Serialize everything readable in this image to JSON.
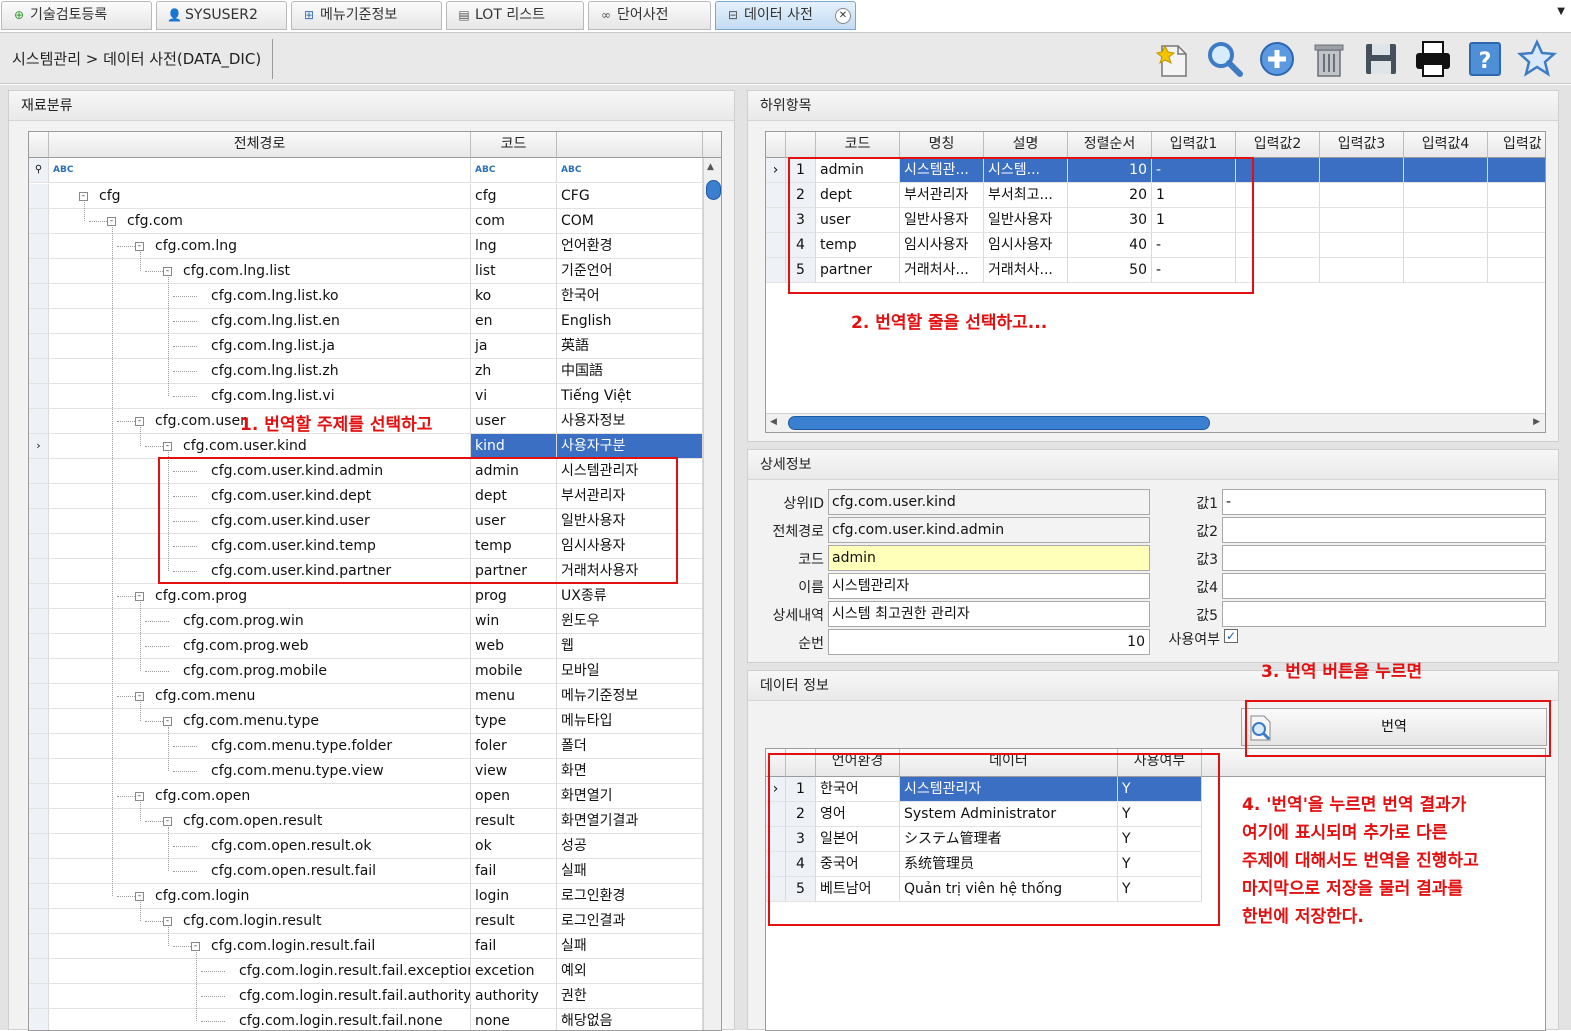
{
  "tabs": [
    {
      "label": "기술검토등록",
      "icon": "plus-circle-icon"
    },
    {
      "label": "SYSUSER2",
      "icon": "user-icon"
    },
    {
      "label": "메뉴기준정보",
      "icon": "sitemap-icon"
    },
    {
      "label": "LOT 리스트",
      "icon": "list-icon"
    },
    {
      "label": "단어사전",
      "icon": "binoculars-icon"
    },
    {
      "label": "데이터 사전",
      "icon": "database-icon",
      "active": true
    }
  ],
  "breadcrumb": "시스템관리  >  데이터 사전(DATA_DIC)",
  "toolbar_icons": [
    "new-document-icon",
    "search-icon",
    "add-icon",
    "delete-icon",
    "save-icon",
    "print-icon",
    "help-icon",
    "favorite-icon"
  ],
  "left_panel": {
    "title": "재료분류",
    "headers": [
      "전체경로",
      "코드",
      ""
    ],
    "filter_glyph": "ABC",
    "rows": [
      {
        "path": "cfg",
        "code": "cfg",
        "name": "CFG",
        "level": 0,
        "toggle": "-"
      },
      {
        "path": "cfg.com",
        "code": "com",
        "name": "COM",
        "level": 1,
        "toggle": "-"
      },
      {
        "path": "cfg.com.lng",
        "code": "lng",
        "name": "언어환경",
        "level": 2,
        "toggle": "-"
      },
      {
        "path": "cfg.com.lng.list",
        "code": "list",
        "name": "기준언어",
        "level": 3,
        "toggle": "-"
      },
      {
        "path": "cfg.com.lng.list.ko",
        "code": "ko",
        "name": "한국어",
        "level": 4
      },
      {
        "path": "cfg.com.lng.list.en",
        "code": "en",
        "name": "English",
        "level": 4
      },
      {
        "path": "cfg.com.lng.list.ja",
        "code": "ja",
        "name": "英語",
        "level": 4
      },
      {
        "path": "cfg.com.lng.list.zh",
        "code": "zh",
        "name": "中国語",
        "level": 4
      },
      {
        "path": "cfg.com.lng.list.vi",
        "code": "vi",
        "name": "Tiếng Việt",
        "level": 4
      },
      {
        "path": "cfg.com.user",
        "code": "user",
        "name": "사용자정보",
        "level": 2,
        "toggle": "-"
      },
      {
        "path": "cfg.com.user.kind",
        "code": "kind",
        "name": "사용자구분",
        "level": 3,
        "toggle": "-",
        "selected": true
      },
      {
        "path": "cfg.com.user.kind.admin",
        "code": "admin",
        "name": "시스템관리자",
        "level": 4
      },
      {
        "path": "cfg.com.user.kind.dept",
        "code": "dept",
        "name": "부서관리자",
        "level": 4
      },
      {
        "path": "cfg.com.user.kind.user",
        "code": "user",
        "name": "일반사용자",
        "level": 4
      },
      {
        "path": "cfg.com.user.kind.temp",
        "code": "temp",
        "name": "임시사용자",
        "level": 4
      },
      {
        "path": "cfg.com.user.kind.partner",
        "code": "partner",
        "name": "거래처사용자",
        "level": 4
      },
      {
        "path": "cfg.com.prog",
        "code": "prog",
        "name": "UX종류",
        "level": 2,
        "toggle": "-"
      },
      {
        "path": "cfg.com.prog.win",
        "code": "win",
        "name": "윈도우",
        "level": 3
      },
      {
        "path": "cfg.com.prog.web",
        "code": "web",
        "name": "웹",
        "level": 3
      },
      {
        "path": "cfg.com.prog.mobile",
        "code": "mobile",
        "name": "모바일",
        "level": 3
      },
      {
        "path": "cfg.com.menu",
        "code": "menu",
        "name": "메뉴기준정보",
        "level": 2,
        "toggle": "-"
      },
      {
        "path": "cfg.com.menu.type",
        "code": "type",
        "name": "메뉴타입",
        "level": 3,
        "toggle": "-"
      },
      {
        "path": "cfg.com.menu.type.folder",
        "code": "foler",
        "name": "폴더",
        "level": 4
      },
      {
        "path": "cfg.com.menu.type.view",
        "code": "view",
        "name": "화면",
        "level": 4
      },
      {
        "path": "cfg.com.open",
        "code": "open",
        "name": "화면열기",
        "level": 2,
        "toggle": "-"
      },
      {
        "path": "cfg.com.open.result",
        "code": "result",
        "name": "화면열기결과",
        "level": 3,
        "toggle": "-"
      },
      {
        "path": "cfg.com.open.result.ok",
        "code": "ok",
        "name": "성공",
        "level": 4
      },
      {
        "path": "cfg.com.open.result.fail",
        "code": "fail",
        "name": "실패",
        "level": 4
      },
      {
        "path": "cfg.com.login",
        "code": "login",
        "name": "로그인환경",
        "level": 2,
        "toggle": "-"
      },
      {
        "path": "cfg.com.login.result",
        "code": "result",
        "name": "로그인결과",
        "level": 3,
        "toggle": "-"
      },
      {
        "path": "cfg.com.login.result.fail",
        "code": "fail",
        "name": "실패",
        "level": 4,
        "toggle": "-"
      },
      {
        "path": "cfg.com.login.result.fail.exception",
        "code": "excetion",
        "name": "예외",
        "level": 5
      },
      {
        "path": "cfg.com.login.result.fail.authority",
        "code": "authority",
        "name": "권한",
        "level": 5
      },
      {
        "path": "cfg.com.login.result.fail.none",
        "code": "none",
        "name": "해당없음",
        "level": 5
      }
    ]
  },
  "sub_panel": {
    "title": "하위항목",
    "headers": [
      "코드",
      "명칭",
      "설명",
      "정렬순서",
      "입력값1",
      "입력값2",
      "입력값3",
      "입력값4",
      "입력값"
    ],
    "rows": [
      {
        "no": "1",
        "code": "admin",
        "name": "시스템관...",
        "desc": "시스템...",
        "order": "10",
        "v1": "-",
        "selected": true
      },
      {
        "no": "2",
        "code": "dept",
        "name": "부서관리자",
        "desc": "부서최고...",
        "order": "20",
        "v1": "1"
      },
      {
        "no": "3",
        "code": "user",
        "name": "일반사용자",
        "desc": "일반사용자",
        "order": "30",
        "v1": "1"
      },
      {
        "no": "4",
        "code": "temp",
        "name": "임시사용자",
        "desc": "임시사용자",
        "order": "40",
        "v1": "-"
      },
      {
        "no": "5",
        "code": "partner",
        "name": "거래처사...",
        "desc": "거래처사...",
        "order": "50",
        "v1": "-"
      }
    ]
  },
  "detail_panel": {
    "title": "상세정보",
    "parent_id_label": "상위ID",
    "parent_id": "cfg.com.user.kind",
    "full_path_label": "전체경로",
    "full_path": "cfg.com.user.kind.admin",
    "code_label": "코드",
    "code": "admin",
    "name_label": "이름",
    "name": "시스템관리자",
    "detail_label": "상세내역",
    "detail": "시스템 최고권한 관리자",
    "seq_label": "순번",
    "seq": "10",
    "value_labels": [
      "값1",
      "값2",
      "값3",
      "값4",
      "값5"
    ],
    "values": [
      "-",
      "",
      "",
      "",
      ""
    ],
    "use_label": "사용여부",
    "use_checked": true
  },
  "data_panel": {
    "title": "데이터 정보",
    "translate_label": "번역",
    "headers": [
      "언어환경",
      "데이터",
      "사용여부"
    ],
    "rows": [
      {
        "no": "1",
        "lang": "한국어",
        "data": "시스템관리자",
        "use": "Y",
        "selected": true
      },
      {
        "no": "2",
        "lang": "영어",
        "data": "System Administrator",
        "use": "Y"
      },
      {
        "no": "3",
        "lang": "일본어",
        "data": "システム管理者",
        "use": "Y"
      },
      {
        "no": "4",
        "lang": "중국어",
        "data": "系统管理员",
        "use": "Y"
      },
      {
        "no": "5",
        "lang": "베트남어",
        "data": "Quản trị viên hệ thống",
        "use": "Y"
      }
    ]
  },
  "annotations": {
    "a1": "1. 번역할 주제를 선택하고",
    "a2": "2. 번역할 줄을 선택하고...",
    "a3": "3. 번역 버튼을 누르면",
    "a4": [
      "4. '번역'을 누르면 번역 결과가",
      "여기에 표시되며 추가로 다른",
      "주제에 대해서도 번역을 진행하고",
      "마지막으로 저장을 물러 결과를",
      "한번에 저장한다."
    ]
  },
  "colors": {
    "selection": "#3a6fc4",
    "annotation": "#e21010",
    "code_highlight": "#ffffb9"
  }
}
